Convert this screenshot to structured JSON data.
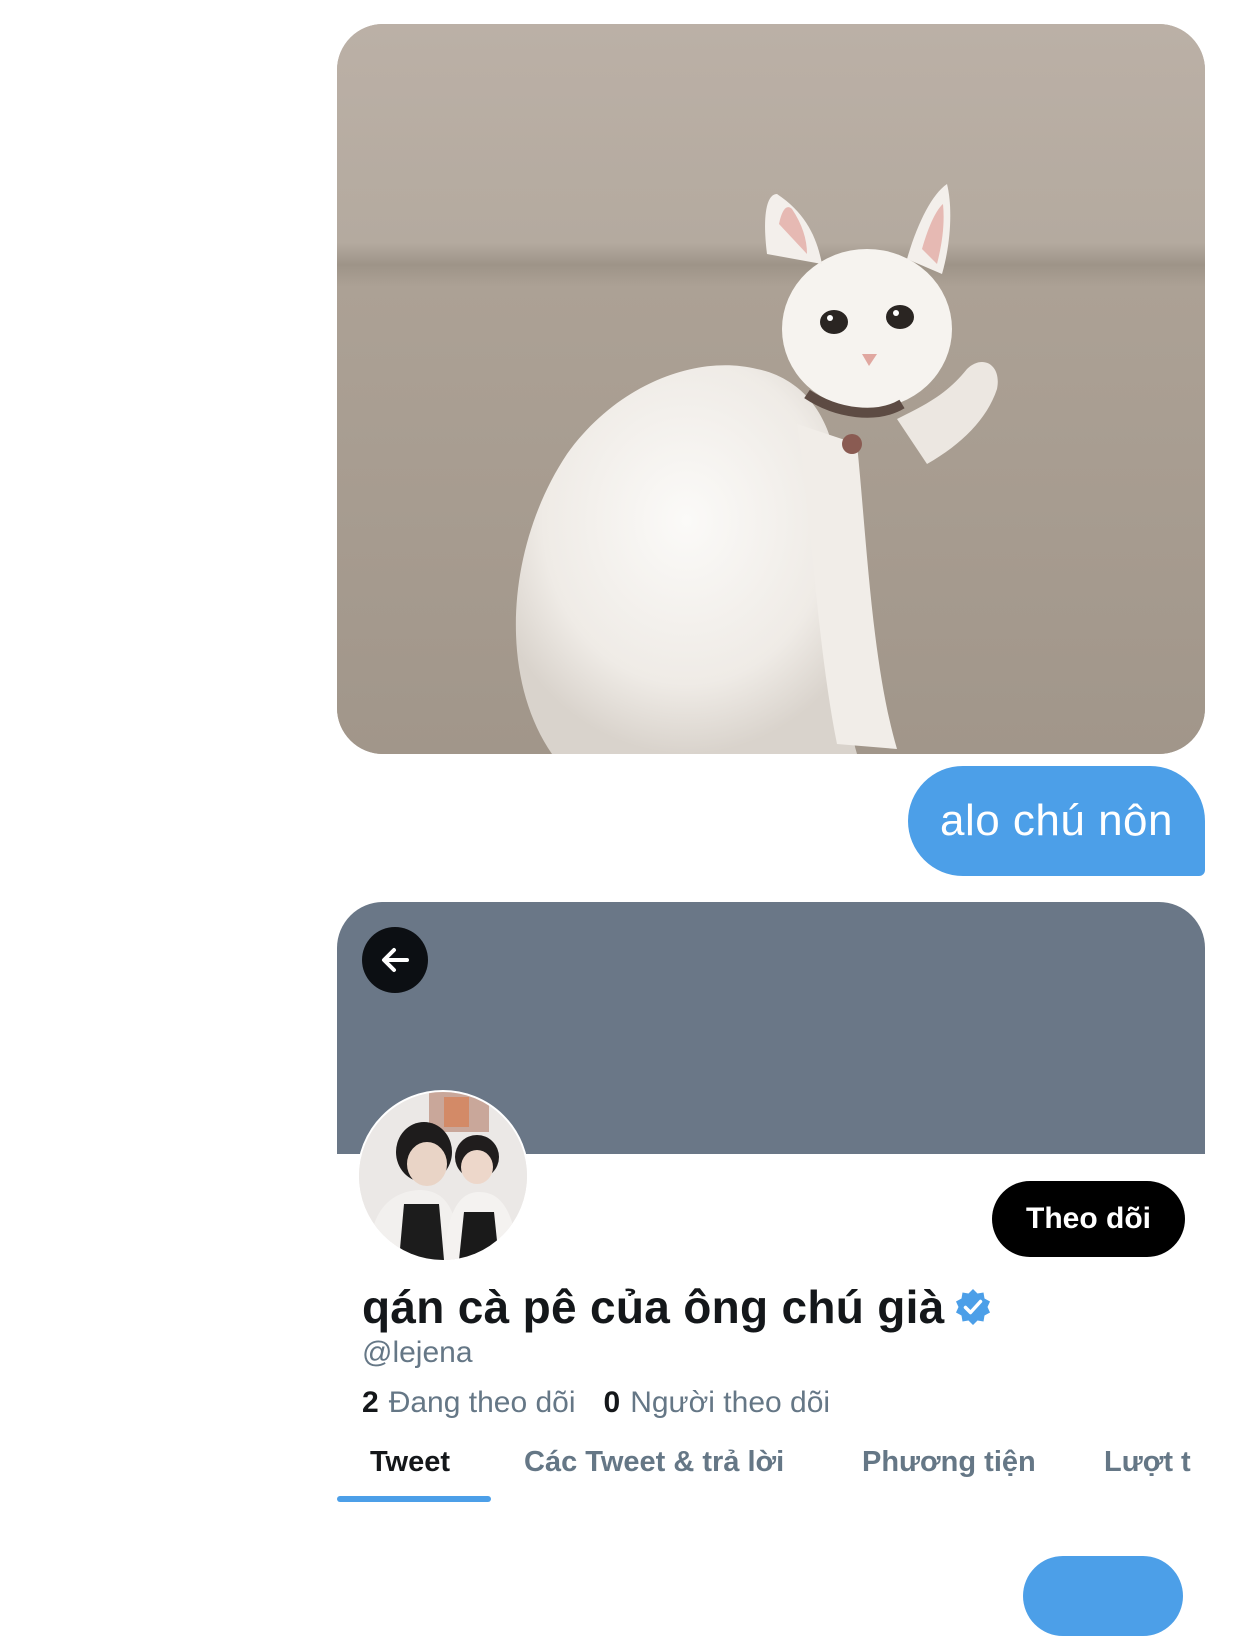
{
  "message_image": {
    "icon": "cat-thumbs-up-photo"
  },
  "message_text": "alo chú nôn",
  "profile": {
    "follow_button": "Theo dõi",
    "display_name": "qán cà pê của ông chú già",
    "handle": "@lejena",
    "following_count": "2",
    "following_label": "Đang theo dõi",
    "followers_count": "0",
    "followers_label": "Người theo dõi",
    "tabs": [
      {
        "label": "Tweet",
        "active": true
      },
      {
        "label": "Các Tweet & trả lời",
        "active": false
      },
      {
        "label": "Phương tiện",
        "active": false
      },
      {
        "label": "Lượt t",
        "active": false
      }
    ]
  },
  "colors": {
    "bubble_blue": "#4c9fe8",
    "banner_gray": "#6a7787",
    "text_dark": "#14171a",
    "text_muted": "#657786",
    "verified_blue": "#4c9fe8"
  }
}
